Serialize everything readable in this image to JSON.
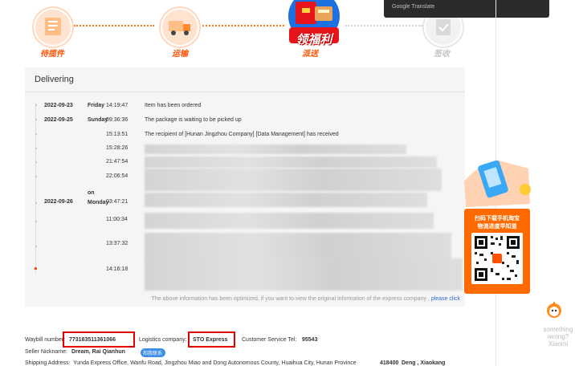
{
  "tracker": {
    "steps": [
      {
        "label": "待揽件",
        "state": "done",
        "icon": "package-icon"
      },
      {
        "label": "运输",
        "state": "done",
        "icon": "truck-icon"
      },
      {
        "label": "派送",
        "state": "current",
        "icon": "gift-icon"
      },
      {
        "label": "签收",
        "state": "pending",
        "icon": "signed-icon"
      }
    ],
    "promo_text": "领福利"
  },
  "tooltip": {
    "text": "Google Translate"
  },
  "panel": {
    "title": "Delivering",
    "events": [
      {
        "date": "2022-09-23",
        "day": "Friday",
        "time": "14:19:47",
        "text": "Item has been ordered"
      },
      {
        "date": "2022-09-25",
        "day": "Sunday",
        "time": "09:36:36",
        "text": "The package is waiting to be picked up"
      },
      {
        "date": "",
        "day": "",
        "time": "15:13:51",
        "text": "The recipient of [Hunan Jingzhou Company] [Data Management] has received"
      },
      {
        "date": "",
        "day": "",
        "time": "15:28:26",
        "text": ""
      },
      {
        "date": "",
        "day": "",
        "time": "21:47:54",
        "text": ""
      },
      {
        "date": "",
        "day": "",
        "time": "22:06:54",
        "text": ""
      },
      {
        "date": "2022-09-26",
        "day": "on Monday",
        "time": "03:47:21",
        "text": ""
      },
      {
        "date": "",
        "day": "",
        "time": "11:00:34",
        "text": ""
      },
      {
        "date": "",
        "day": "",
        "time": "13:37:32",
        "text": ""
      },
      {
        "date": "",
        "day": "",
        "time": "14:16:18",
        "text": ""
      }
    ],
    "footer_text": "The above information has been optimized, if you want to view the original information of the express company ,",
    "footer_link": "please click"
  },
  "qr_promo": {
    "line1": "扫码下载手机淘宝",
    "line2": "物流进度早知道"
  },
  "info": {
    "waybill_label": "Waybill number:",
    "waybill_value": "773183511361066",
    "company_label": "Logistics company:",
    "company_value": "STO Express",
    "service_label": "Customer Service Tel:",
    "service_value": "95543",
    "seller_label": "Seller Nickname:",
    "seller_value": "Dream, Rai Qianhun",
    "seller_tag": "和我联系",
    "address_label": "Shipping Address:",
    "address_value": "Yunda Express Office, Wanfu Road, Jingzhou Miao and Dong Autonomous County, Huaihua City, Hunan Province",
    "address_zip": "418400",
    "address_tail": "Deng , Xiaokang"
  },
  "bot": {
    "text": "something wrong? Xiaomi"
  },
  "colors": {
    "accent": "#ff5000",
    "highlight_box": "#e00000",
    "link": "#3366cc"
  }
}
